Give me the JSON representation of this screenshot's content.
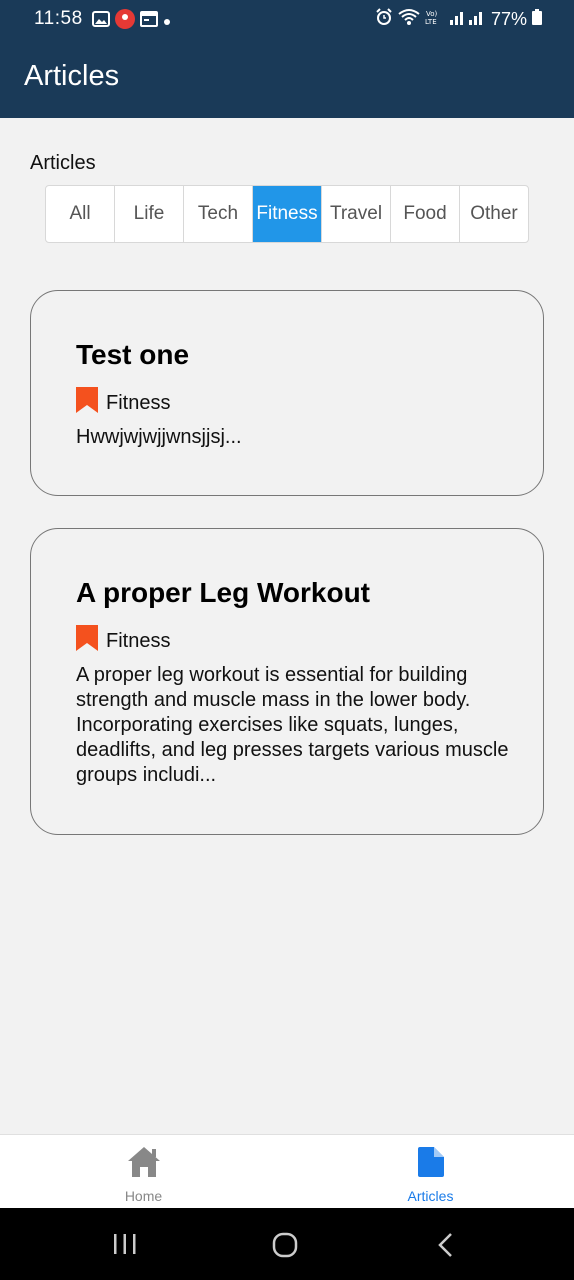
{
  "status_bar": {
    "time": "11:58",
    "battery": "77%",
    "icons": [
      "gallery-icon",
      "app-notification-icon",
      "calendar-icon",
      "alarm-icon",
      "wifi-icon",
      "volte-icon",
      "signal-icon",
      "battery-icon"
    ]
  },
  "app_bar": {
    "title": "Articles"
  },
  "filter": {
    "label": "Articles",
    "segments": [
      "All",
      "Life",
      "Tech",
      "Fitness",
      "Travel",
      "Food",
      "Other"
    ],
    "selected": "Fitness",
    "accent": "#2196e8"
  },
  "articles": [
    {
      "title": "Test one",
      "category": "Fitness",
      "excerpt": "Hwwjwjwjjwnsjjsj..."
    },
    {
      "title": "A proper Leg Workout",
      "category": "Fitness",
      "excerpt": "A proper leg workout is essential for building strength and muscle mass in the lower body. Incorporating exercises like squats, lunges, deadlifts, and leg presses targets various muscle groups includi..."
    }
  ],
  "bottom_nav": {
    "items": [
      {
        "label": "Home",
        "icon": "home-icon"
      },
      {
        "label": "Articles",
        "icon": "document-icon"
      }
    ],
    "active": "Articles"
  },
  "colors": {
    "header": "#1a3a58",
    "bookmark": "#f4511e",
    "active_nav": "#1a7be8"
  }
}
